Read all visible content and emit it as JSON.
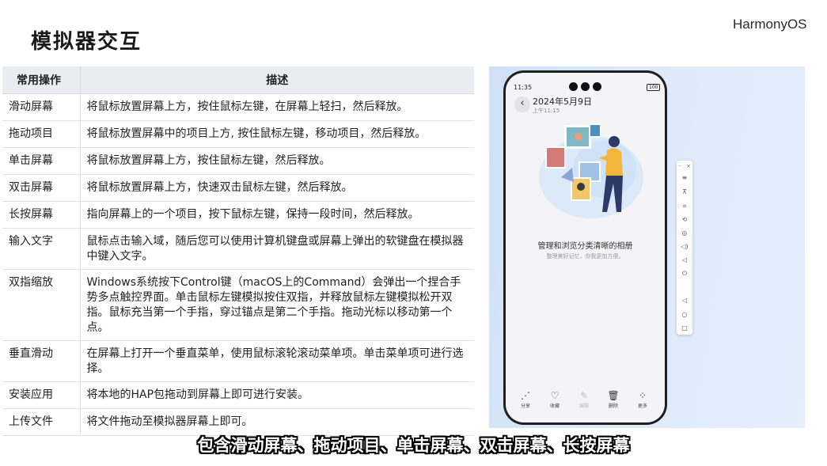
{
  "slide": {
    "title": "模拟器交互",
    "brand": "HarmonyOS"
  },
  "table": {
    "headers": [
      "常用操作",
      "描述"
    ],
    "rows": [
      {
        "op": "滑动屏幕",
        "desc": "将鼠标放置屏幕上方，按住鼠标左键，在屏幕上轻扫，然后释放。"
      },
      {
        "op": "拖动项目",
        "desc": "将鼠标放置屏幕中的项目上方, 按住鼠标左键，移动项目，然后释放。"
      },
      {
        "op": "单击屏幕",
        "desc": "将鼠标放置屏幕上方，按住鼠标左键，然后释放。"
      },
      {
        "op": "双击屏幕",
        "desc": "将鼠标放置屏幕上方，快速双击鼠标左键，然后释放。"
      },
      {
        "op": "长按屏幕",
        "desc": "指向屏幕上的一个项目，按下鼠标左键，保持一段时间，然后释放。"
      },
      {
        "op": "输入文字",
        "desc": "鼠标点击输入域，随后您可以使用计算机键盘或屏幕上弹出的软键盘在模拟器中键入文字。"
      },
      {
        "op": "双指缩放",
        "desc": "Windows系统按下Control键（macOS上的Command）会弹出一个捏合手势多点触控界面。单击鼠标左键模拟按住双指，并释放鼠标左键模拟松开双指。鼠标充当第一个手指，穿过锚点是第二个手指。拖动光标以移动第一个点。"
      },
      {
        "op": "垂直滑动",
        "desc": "在屏幕上打开一个垂直菜单，使用鼠标滚轮滚动菜单项。单击菜单项可进行选择。"
      },
      {
        "op": "安装应用",
        "desc": "将本地的HAP包拖动到屏幕上即可进行安装。"
      },
      {
        "op": "上传文件",
        "desc": "将文件拖动至模拟器屏幕上即可。"
      }
    ]
  },
  "phone": {
    "status_time": "11:35",
    "battery": "100",
    "date": "2024年5月9日",
    "time": "上午11:15",
    "empty_title": "管理和浏览分类清晰的相册",
    "empty_subtitle": "整理美好记忆，你我更加方便。",
    "bottom_actions": [
      {
        "label": "分享",
        "icon": "share-icon",
        "glyph": "⋰",
        "disabled": false
      },
      {
        "label": "收藏",
        "icon": "heart-icon",
        "glyph": "♡",
        "disabled": false
      },
      {
        "label": "编辑",
        "icon": "edit-icon",
        "glyph": "✎",
        "disabled": true
      },
      {
        "label": "删除",
        "icon": "trash-icon",
        "glyph": "🗑",
        "disabled": false
      },
      {
        "label": "更多",
        "icon": "more-icon",
        "glyph": "⁘",
        "disabled": false
      }
    ]
  },
  "emulator_toolbar": {
    "top_controls": [
      "-",
      "×"
    ],
    "buttons": [
      {
        "icon": "menu-icon",
        "glyph": "≡"
      },
      {
        "icon": "pin-top-icon",
        "glyph": "⊼"
      },
      {
        "icon": "crop-icon",
        "glyph": "⌗"
      },
      {
        "icon": "rotate-icon",
        "glyph": "⟲"
      },
      {
        "icon": "location-icon",
        "glyph": "◎"
      },
      {
        "icon": "volume-up-icon",
        "glyph": "◁)"
      },
      {
        "icon": "volume-down-icon",
        "glyph": "◁"
      },
      {
        "icon": "power-icon",
        "glyph": "⏻"
      },
      {
        "icon": "nav-back-icon",
        "glyph": "◁"
      },
      {
        "icon": "nav-home-icon",
        "glyph": "○"
      },
      {
        "icon": "nav-recent-icon",
        "glyph": "□"
      }
    ]
  },
  "caption": "包含滑动屏幕、拖动项目、单击屏幕、双击屏幕、长按屏幕"
}
